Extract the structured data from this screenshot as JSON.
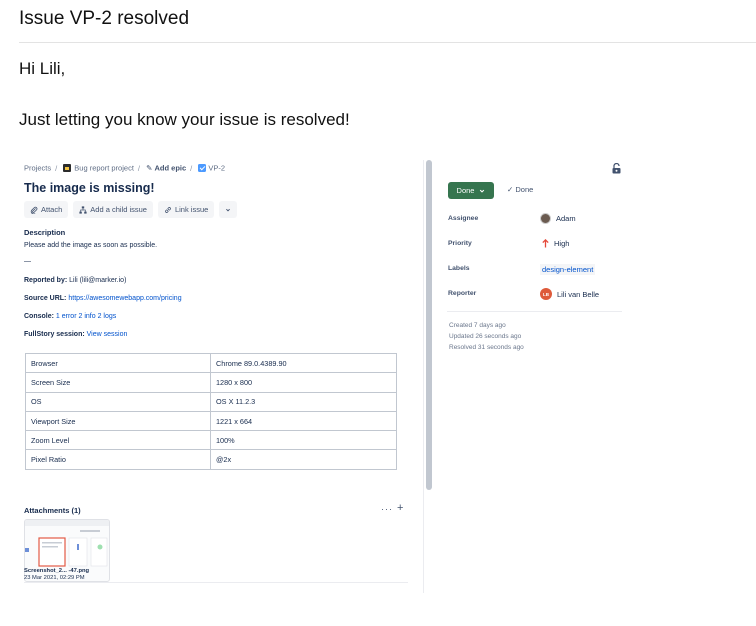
{
  "email": {
    "subject": "Issue VP-2 resolved",
    "greeting": "Hi Lili,",
    "body": "Just letting you know your issue is resolved!"
  },
  "jira": {
    "breadcrumbs": {
      "projects": "Projects",
      "project": "Bug report project",
      "add_epic": "Add epic",
      "issue_key": "VP-2"
    },
    "issue_title": "The image is missing!",
    "actions": {
      "attach": "Attach",
      "add_child": "Add a child issue",
      "link_issue": "Link issue"
    },
    "description": {
      "heading": "Description",
      "text": "Please add the image as soon as possible.",
      "dash": "—",
      "reported_by_label": "Reported by:",
      "reported_by_value": "Lili (lili@marker.io)",
      "source_url_label": "Source URL:",
      "source_url_value": "https://awesomewebapp.com/pricing",
      "console_label": "Console:",
      "console_errors": "1 error",
      "console_info": "2 info",
      "console_logs": "2 logs",
      "fullstory_label": "FullStory session:",
      "fullstory_link": "View session"
    },
    "details": [
      {
        "key": "Browser",
        "value": "Chrome 89.0.4389.90"
      },
      {
        "key": "Screen Size",
        "value": "1280 x 800"
      },
      {
        "key": "OS",
        "value": "OS X 11.2.3"
      },
      {
        "key": "Viewport Size",
        "value": "1221 x 664"
      },
      {
        "key": "Zoom Level",
        "value": "100%"
      },
      {
        "key": "Pixel Ratio",
        "value": "@2x"
      }
    ],
    "attachments": {
      "title": "Attachments (1)",
      "more": "···",
      "add": "+",
      "file_name": "Screenshot_2... -47.png",
      "file_date": "23 Mar 2021, 02:29 PM"
    },
    "sidebar": {
      "status_button": "Done",
      "status_text": "Done",
      "assignee_label": "Assignee",
      "assignee_value": "Adam",
      "priority_label": "Priority",
      "priority_value": "High",
      "labels_label": "Labels",
      "labels_value": "design-element",
      "reporter_label": "Reporter",
      "reporter_value": "Lili van Belle",
      "reporter_initials": "LB",
      "created": "Created 7 days ago",
      "updated": "Updated 26 seconds ago",
      "resolved": "Resolved 31 seconds ago"
    },
    "colors": {
      "done_green": "#36754f",
      "link_blue": "#0052cc",
      "priority_red": "#e5493a"
    }
  }
}
